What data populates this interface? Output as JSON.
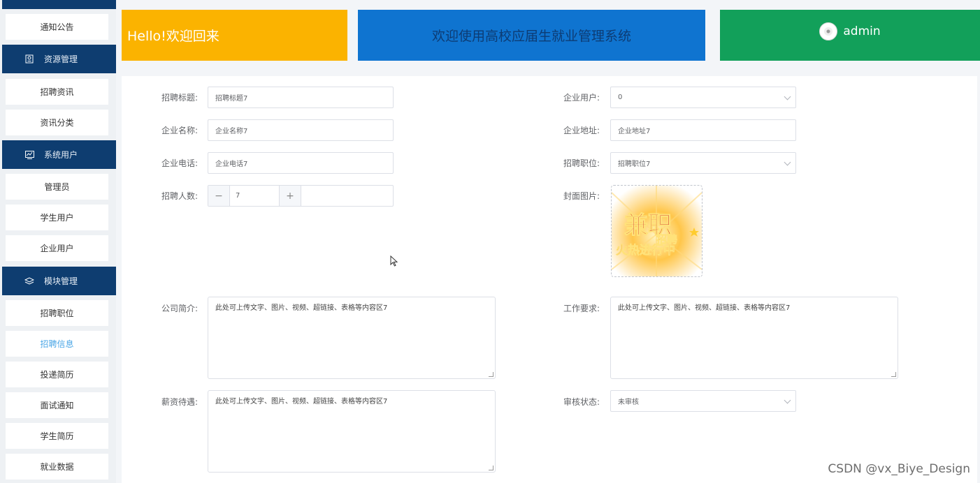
{
  "sidebar": {
    "items": [
      {
        "type": "item",
        "label": "通知公告"
      },
      {
        "type": "group",
        "label": "资源管理",
        "icon": "resource-icon"
      },
      {
        "type": "item",
        "label": "招聘资讯"
      },
      {
        "type": "item",
        "label": "资讯分类"
      },
      {
        "type": "group",
        "label": "系统用户",
        "icon": "chart-icon"
      },
      {
        "type": "item",
        "label": "管理员"
      },
      {
        "type": "item",
        "label": "学生用户"
      },
      {
        "type": "item",
        "label": "企业用户"
      },
      {
        "type": "group",
        "label": "模块管理",
        "icon": "module-icon"
      },
      {
        "type": "item",
        "label": "招聘职位"
      },
      {
        "type": "item",
        "label": "招聘信息",
        "active": true
      },
      {
        "type": "item",
        "label": "投递简历"
      },
      {
        "type": "item",
        "label": "面试通知"
      },
      {
        "type": "item",
        "label": "学生简历"
      },
      {
        "type": "item",
        "label": "就业数据"
      }
    ]
  },
  "header": {
    "hello": "Hello!欢迎回来",
    "system_title": "欢迎使用高校应届生就业管理系统",
    "username": "admin"
  },
  "form": {
    "title_label": "招聘标题:",
    "title_value": "招聘标题7",
    "company_user_label": "企业用户:",
    "company_user_value": "0",
    "company_name_label": "企业名称:",
    "company_name_value": "企业名称7",
    "company_address_label": "企业地址:",
    "company_address_value": "企业地址7",
    "company_phone_label": "企业电话:",
    "company_phone_value": "企业电话7",
    "position_label": "招聘职位:",
    "position_value": "招聘职位7",
    "count_label": "招聘人数:",
    "count_value": "7",
    "cover_label": "封面图片:",
    "cover_text_big": "兼职",
    "cover_text_mid": "招聘",
    "cover_text_small": "火热进行中",
    "intro_label": "公司简介:",
    "intro_value": "此处可上传文字、图片、视频、超链接、表格等内容区7",
    "requirement_label": "工作要求:",
    "requirement_value": "此处可上传文字、图片、视频、超链接、表格等内容区7",
    "salary_label": "薪资待遇:",
    "salary_value": "此处可上传文字、图片、视频、超链接、表格等内容区7",
    "review_label": "审核状态:",
    "review_value": "未审核"
  },
  "watermark": "CSDN @vx_Biye_Design",
  "colors": {
    "sidebar_group": "#0e3d70",
    "hello_card": "#fbb300",
    "system_card": "#0f74d0",
    "user_card": "#12a05a",
    "active_item": "#4aa6e6"
  }
}
